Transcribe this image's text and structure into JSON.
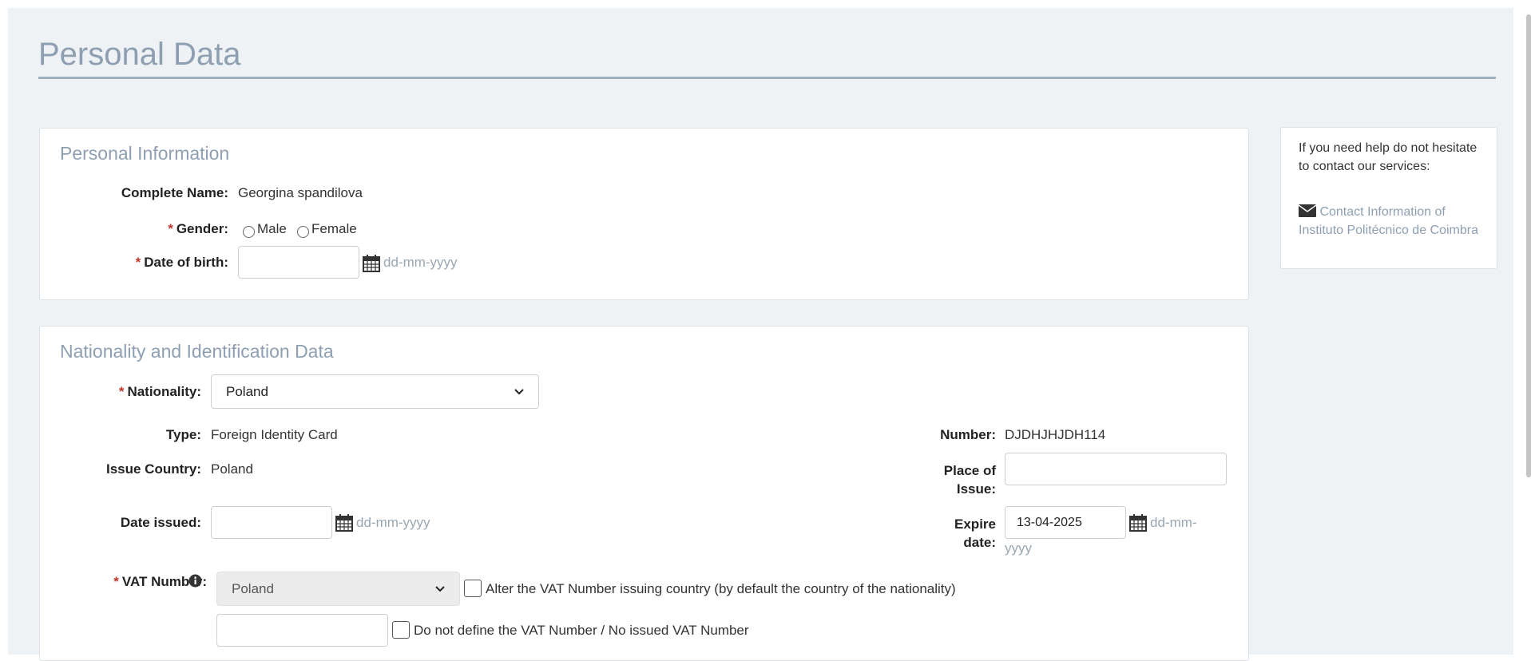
{
  "page_title": "Personal Data",
  "personal_info": {
    "title": "Personal Information",
    "complete_name_label": "Complete Name:",
    "complete_name_value": "Georgina spandilova",
    "gender_label": "Gender:",
    "gender_options": [
      "Male",
      "Female"
    ],
    "dob_label": "Date of birth:",
    "dob_value": "",
    "date_format_hint": "dd-mm-yyyy"
  },
  "nationality": {
    "title": "Nationality and Identification Data",
    "nationality_label": "Nationality:",
    "nationality_value": "Poland",
    "type_label": "Type:",
    "type_value": "Foreign Identity Card",
    "issue_country_label": "Issue Country:",
    "issue_country_value": "Poland",
    "date_issued_label": "Date issued:",
    "date_issued_hint": "dd-mm-yyyy",
    "number_label": "Number:",
    "number_value": "DJDHJHJDH114",
    "place_of_issue_label_1": "Place of",
    "place_of_issue_label_2": "Issue:",
    "expire_label_1": "Expire",
    "expire_label_2": "date:",
    "expire_value": "13-04-2025",
    "expire_hint_1": "dd-mm-",
    "expire_hint_2": "yyyy",
    "vat_label": "VAT Number:",
    "vat_country_value": "Poland",
    "alter_vat_label": "Alter the VAT Number issuing country (by default the country of the nationality)",
    "no_vat_label": "Do not define the VAT Number / No issued VAT Number"
  },
  "help": {
    "text": "If you need help do not hesitate to contact our services:",
    "link": "Contact Information of Instituto Politécnico de Coimbra"
  },
  "required_marker": "*"
}
